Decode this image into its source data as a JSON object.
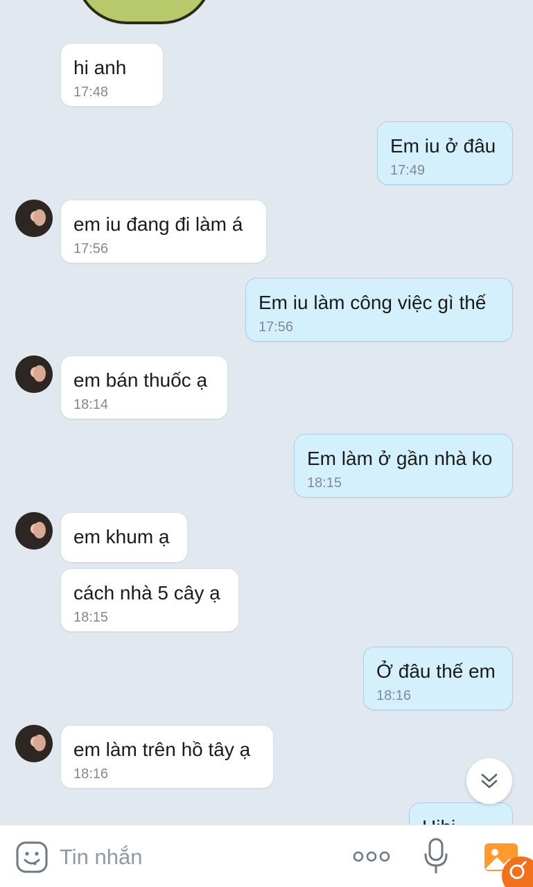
{
  "messages": [
    {
      "side": "in",
      "text": "hi anh",
      "time": "17:48"
    },
    {
      "side": "out",
      "text": "Em iu ở đâu",
      "time": "17:49"
    },
    {
      "side": "in",
      "text": "em iu đang đi làm á",
      "time": "17:56"
    },
    {
      "side": "out",
      "text": "Em iu làm công việc gì thế",
      "time": "17:56"
    },
    {
      "side": "in",
      "text": "em bán thuốc ạ",
      "time": "18:14"
    },
    {
      "side": "out",
      "text": "Em làm ở gần nhà ko",
      "time": "18:15"
    },
    {
      "side": "in",
      "text": "em khum ạ",
      "time": ""
    },
    {
      "side": "in",
      "text": "cách nhà 5 cây ạ",
      "time": "18:15"
    },
    {
      "side": "out",
      "text": "Ở đâu thế em",
      "time": "18:16"
    },
    {
      "side": "in",
      "text": "em làm trên hồ tây ạ",
      "time": "18:16"
    },
    {
      "side": "out",
      "text": "Hihi",
      "time": ""
    }
  ],
  "composer": {
    "placeholder": "Tin nhắn"
  },
  "icons": {
    "emoji": "sticker-emoji-icon",
    "more": "more-dots-icon",
    "mic": "microphone-icon",
    "gallery": "image-gallery-icon",
    "scroll": "double-chevron-down-icon"
  },
  "colors": {
    "background": "#e2e8f0",
    "incoming_bubble": "#ffffff",
    "outgoing_bubble": "#d5f0fd",
    "accent": "#f0711e"
  }
}
